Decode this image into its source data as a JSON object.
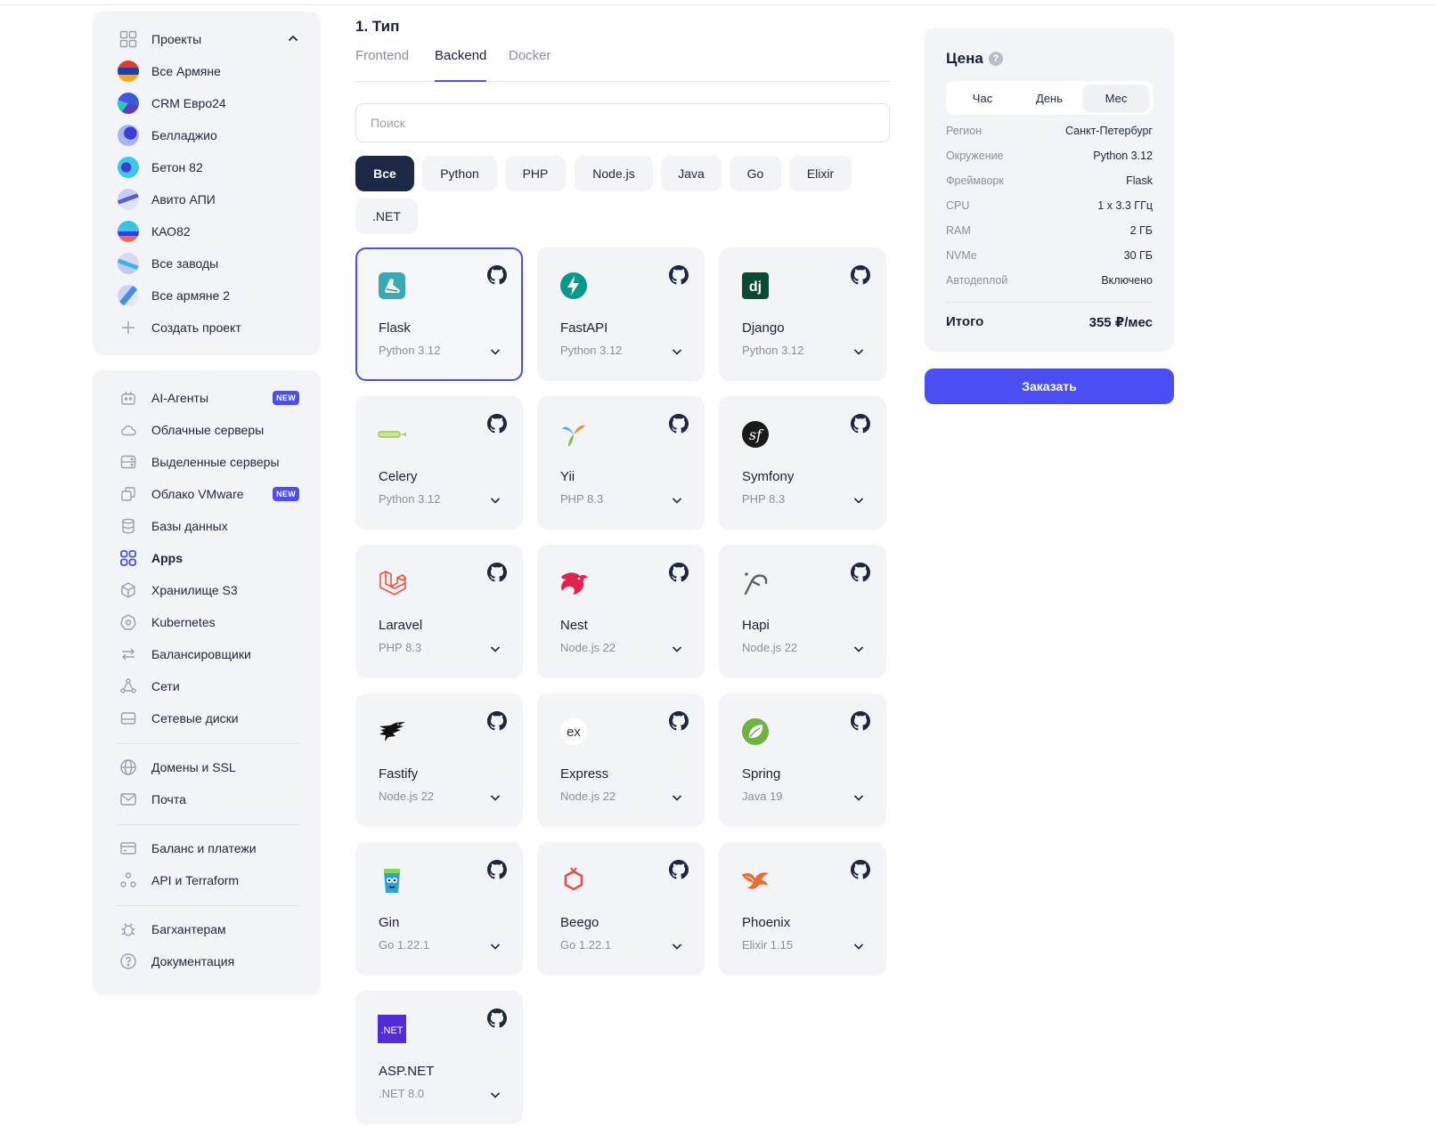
{
  "projects": {
    "header_label": "Проекты",
    "items": [
      {
        "label": "Все Армяне"
      },
      {
        "label": "CRM Евро24"
      },
      {
        "label": "Белладжио"
      },
      {
        "label": "Бетон 82"
      },
      {
        "label": "Авито АПИ"
      },
      {
        "label": "КАО82"
      },
      {
        "label": "Все заводы"
      },
      {
        "label": "Все армяне 2"
      }
    ],
    "create_label": "Создать проект"
  },
  "nav": {
    "items": [
      {
        "label": "AI-Агенты",
        "badge": "NEW"
      },
      {
        "label": "Облачные серверы"
      },
      {
        "label": "Выделенные серверы"
      },
      {
        "label": "Облако VMware",
        "badge": "NEW"
      },
      {
        "label": "Базы данных"
      },
      {
        "label": "Apps"
      },
      {
        "label": "Хранилище S3"
      },
      {
        "label": "Kubernetes"
      },
      {
        "label": "Балансировщики"
      },
      {
        "label": "Сети"
      },
      {
        "label": "Сетевые диски"
      },
      {
        "label": "Домены и SSL"
      },
      {
        "label": "Почта"
      },
      {
        "label": "Баланс и платежи"
      },
      {
        "label": "API и Terraform"
      },
      {
        "label": "Багхантерам"
      },
      {
        "label": "Документация"
      }
    ],
    "active": "Apps"
  },
  "main": {
    "section_title": "1. Тип",
    "tabs": [
      {
        "label": "Frontend"
      },
      {
        "label": "Backend"
      },
      {
        "label": "Docker"
      }
    ],
    "active_tab": "Backend",
    "search": {
      "placeholder": "Поиск",
      "value": ""
    },
    "filters": [
      {
        "label": "Все"
      },
      {
        "label": "Python"
      },
      {
        "label": "PHP"
      },
      {
        "label": "Node.js"
      },
      {
        "label": "Java"
      },
      {
        "label": "Go"
      },
      {
        "label": "Elixir"
      },
      {
        "label": ".NET"
      }
    ],
    "active_filter": "Все",
    "frameworks": [
      {
        "name": "Flask",
        "runtime": "Python 3.12",
        "icon": "flask-logo-icon"
      },
      {
        "name": "FastAPI",
        "runtime": "Python 3.12",
        "icon": "fastapi-logo-icon"
      },
      {
        "name": "Django",
        "runtime": "Python 3.12",
        "icon": "django-logo-icon"
      },
      {
        "name": "Celery",
        "runtime": "Python 3.12",
        "icon": "celery-logo-icon"
      },
      {
        "name": "Yii",
        "runtime": "PHP 8.3",
        "icon": "yii-logo-icon"
      },
      {
        "name": "Symfony",
        "runtime": "PHP 8.3",
        "icon": "symfony-logo-icon"
      },
      {
        "name": "Laravel",
        "runtime": "PHP 8.3",
        "icon": "laravel-logo-icon"
      },
      {
        "name": "Nest",
        "runtime": "Node.js 22",
        "icon": "nest-logo-icon"
      },
      {
        "name": "Hapi",
        "runtime": "Node.js 22",
        "icon": "hapi-logo-icon"
      },
      {
        "name": "Fastify",
        "runtime": "Node.js 22",
        "icon": "fastify-logo-icon"
      },
      {
        "name": "Express",
        "runtime": "Node.js 22",
        "icon": "express-logo-icon",
        "logo_text": "ex"
      },
      {
        "name": "Spring",
        "runtime": "Java 19",
        "icon": "spring-logo-icon"
      },
      {
        "name": "Gin",
        "runtime": "Go 1.22.1",
        "icon": "gin-logo-icon"
      },
      {
        "name": "Beego",
        "runtime": "Go 1.22.1",
        "icon": "beego-logo-icon"
      },
      {
        "name": "Phoenix",
        "runtime": "Elixir 1.15",
        "icon": "phoenix-logo-icon"
      },
      {
        "name": "ASP.NET",
        "runtime": ".NET 8.0",
        "icon": "dotnet-logo-icon",
        "logo_text": ".NET"
      }
    ],
    "selected": "Flask"
  },
  "price": {
    "title": "Цена",
    "periods": [
      {
        "label": "Час"
      },
      {
        "label": "День"
      },
      {
        "label": "Мес"
      }
    ],
    "active_period": "Мес",
    "rows": [
      {
        "key": "Регион",
        "value": "Санкт-Петербург"
      },
      {
        "key": "Окружение",
        "value": "Python 3.12"
      },
      {
        "key": "Фреймворк",
        "value": "Flask"
      },
      {
        "key": "CPU",
        "value": "1 x 3.3 ГГц"
      },
      {
        "key": "RAM",
        "value": "2 ГБ"
      },
      {
        "key": "NVMe",
        "value": "30 ГБ"
      },
      {
        "key": "Автодеплой",
        "value": "Включено"
      }
    ],
    "total_label": "Итого",
    "total_value": "355 ₽/мес",
    "order_label": "Заказать"
  },
  "colors": {
    "accent": "#4b4ef0",
    "chip_active": "#1d2746",
    "panel_bg": "#f3f4f7"
  }
}
